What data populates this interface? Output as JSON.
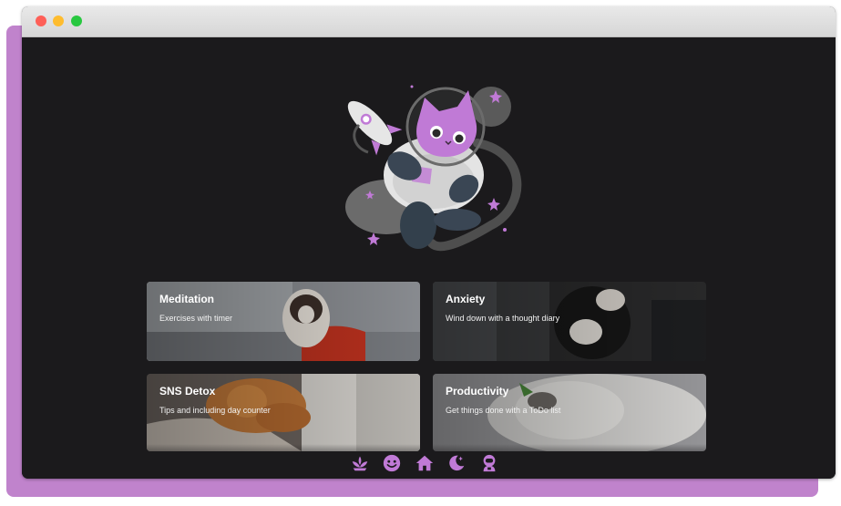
{
  "colors": {
    "accent": "#c07ad6",
    "background": "#1b1a1c",
    "frame": "#c083cc"
  },
  "hero": {
    "icon": "astronaut-cat-illustration"
  },
  "cards": [
    {
      "title": "Meditation",
      "description": "Exercises with timer"
    },
    {
      "title": "Anxiety",
      "description": "Wind down with a thought diary"
    },
    {
      "title": "SNS Detox",
      "description": "Tips and including day counter"
    },
    {
      "title": "Productivity",
      "description": "Get things done with a ToDo list"
    }
  ],
  "nav": [
    {
      "icon": "lotus-icon"
    },
    {
      "icon": "smiley-icon"
    },
    {
      "icon": "home-icon"
    },
    {
      "icon": "moon-icon"
    },
    {
      "icon": "astronaut-icon"
    }
  ]
}
